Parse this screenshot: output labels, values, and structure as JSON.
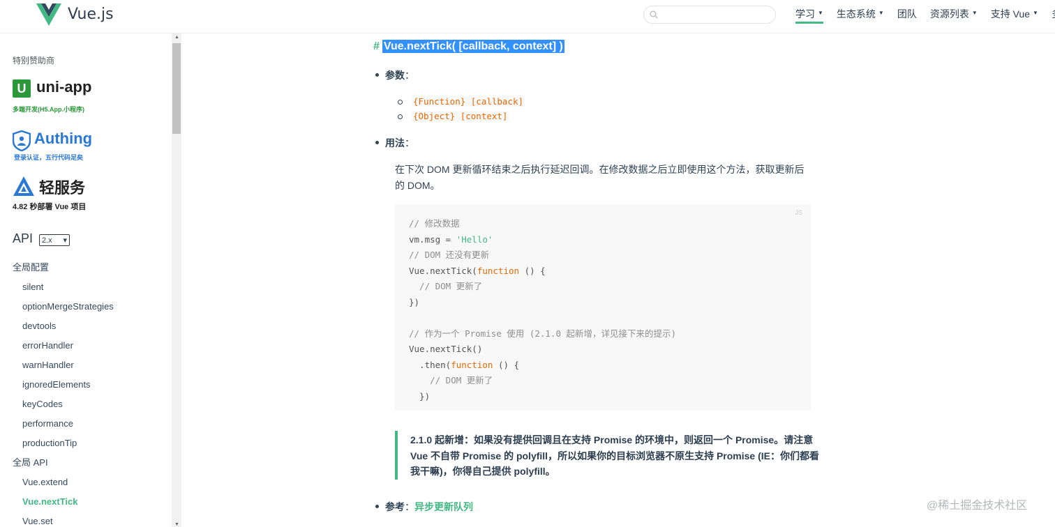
{
  "header": {
    "logo_text": "Vue.js",
    "search_placeholder": "",
    "nav": [
      {
        "label": "学习",
        "caret": "▼",
        "active": true
      },
      {
        "label": "生态系统",
        "caret": "▼"
      },
      {
        "label": "团队",
        "caret": ""
      },
      {
        "label": "资源列表",
        "caret": "▼"
      },
      {
        "label": "支持 Vue",
        "caret": "▼"
      },
      {
        "label": "多",
        "caret": ""
      }
    ]
  },
  "sidebar": {
    "sponsor_title": "特别赞助商",
    "sponsors": [
      {
        "mark": "U",
        "name": "uni-app",
        "sub": "多端开发(H5.App.小程序)"
      },
      {
        "name": "Authing",
        "sub": "登录认证，五行代码足矣"
      },
      {
        "name": "轻服务",
        "sub": "4.82 秒部署 Vue 项目"
      }
    ],
    "api_title": "API",
    "version_select": "2.x",
    "select_arrow": "▾",
    "items": [
      {
        "label": "全局配置"
      },
      {
        "label": "silent"
      },
      {
        "label": "optionMergeStrategies"
      },
      {
        "label": "devtools"
      },
      {
        "label": "errorHandler"
      },
      {
        "label": "warnHandler"
      },
      {
        "label": "ignoredElements"
      },
      {
        "label": "keyCodes"
      },
      {
        "label": "performance"
      },
      {
        "label": "productionTip"
      },
      {
        "label": "全局 API"
      },
      {
        "label": "Vue.extend"
      },
      {
        "label": "Vue.nextTick"
      },
      {
        "label": "Vue.set"
      }
    ]
  },
  "scrollbar": {
    "up": "▲",
    "down": "▼"
  },
  "main": {
    "hash": "#",
    "heading": "Vue.nextTick( [callback, context] )",
    "params_label": "参数",
    "params_colon": "：",
    "params": [
      "{Function} [callback]",
      "{Object} [context]"
    ],
    "usage_label": "用法",
    "usage_colon": "：",
    "usage_text": "在下次 DOM 更新循环结束之后执行延迟回调。在修改数据之后立即使用这个方法，获取更新后的 DOM。",
    "code_lang": "JS",
    "code_lines": [
      "// 修改数据",
      "vm.msg = 'Hello'",
      "// DOM 还没有更新",
      "Vue.nextTick(function () {",
      "  // DOM 更新了",
      "})",
      "",
      "// 作为一个 Promise 使用 (2.1.0 起新增，详见接下来的提示)",
      "Vue.nextTick()",
      "  .then(function () {",
      "    // DOM 更新了",
      "  })"
    ],
    "tip_lines": [
      "2.1.0 起新增：如果没有提供回调且在支持 Promise 的环境中，则返回一个 Promise。请注意",
      "Vue 不自带 Promise 的 polyfill，所以如果你的目标浏览器不原生支持 Promise (IE：你们都看",
      "我干嘛)，你得自己提供 polyfill。"
    ],
    "ref_label": "参考",
    "ref_colon": "：",
    "ref_link": "异步更新队列"
  },
  "watermark": "@稀土掘金技术社区",
  "colors": {
    "accent": "#42b983",
    "selection": "#3390ff",
    "code_keyword": "#e96900"
  }
}
